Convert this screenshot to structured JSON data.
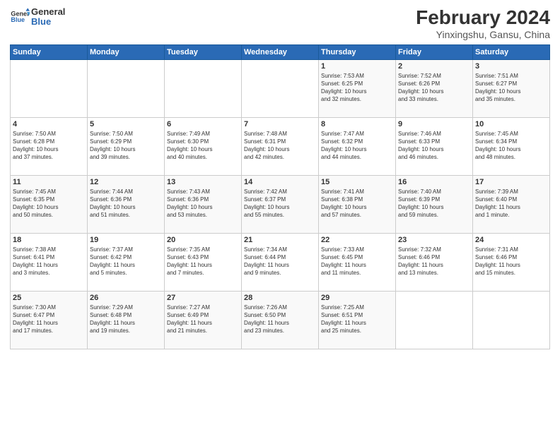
{
  "logo": {
    "line1": "General",
    "line2": "Blue"
  },
  "title": "February 2024",
  "subtitle": "Yinxingshu, Gansu, China",
  "days_of_week": [
    "Sunday",
    "Monday",
    "Tuesday",
    "Wednesday",
    "Thursday",
    "Friday",
    "Saturday"
  ],
  "weeks": [
    [
      {
        "day": "",
        "info": ""
      },
      {
        "day": "",
        "info": ""
      },
      {
        "day": "",
        "info": ""
      },
      {
        "day": "",
        "info": ""
      },
      {
        "day": "1",
        "info": "Sunrise: 7:53 AM\nSunset: 6:25 PM\nDaylight: 10 hours\nand 32 minutes."
      },
      {
        "day": "2",
        "info": "Sunrise: 7:52 AM\nSunset: 6:26 PM\nDaylight: 10 hours\nand 33 minutes."
      },
      {
        "day": "3",
        "info": "Sunrise: 7:51 AM\nSunset: 6:27 PM\nDaylight: 10 hours\nand 35 minutes."
      }
    ],
    [
      {
        "day": "4",
        "info": "Sunrise: 7:50 AM\nSunset: 6:28 PM\nDaylight: 10 hours\nand 37 minutes."
      },
      {
        "day": "5",
        "info": "Sunrise: 7:50 AM\nSunset: 6:29 PM\nDaylight: 10 hours\nand 39 minutes."
      },
      {
        "day": "6",
        "info": "Sunrise: 7:49 AM\nSunset: 6:30 PM\nDaylight: 10 hours\nand 40 minutes."
      },
      {
        "day": "7",
        "info": "Sunrise: 7:48 AM\nSunset: 6:31 PM\nDaylight: 10 hours\nand 42 minutes."
      },
      {
        "day": "8",
        "info": "Sunrise: 7:47 AM\nSunset: 6:32 PM\nDaylight: 10 hours\nand 44 minutes."
      },
      {
        "day": "9",
        "info": "Sunrise: 7:46 AM\nSunset: 6:33 PM\nDaylight: 10 hours\nand 46 minutes."
      },
      {
        "day": "10",
        "info": "Sunrise: 7:45 AM\nSunset: 6:34 PM\nDaylight: 10 hours\nand 48 minutes."
      }
    ],
    [
      {
        "day": "11",
        "info": "Sunrise: 7:45 AM\nSunset: 6:35 PM\nDaylight: 10 hours\nand 50 minutes."
      },
      {
        "day": "12",
        "info": "Sunrise: 7:44 AM\nSunset: 6:36 PM\nDaylight: 10 hours\nand 51 minutes."
      },
      {
        "day": "13",
        "info": "Sunrise: 7:43 AM\nSunset: 6:36 PM\nDaylight: 10 hours\nand 53 minutes."
      },
      {
        "day": "14",
        "info": "Sunrise: 7:42 AM\nSunset: 6:37 PM\nDaylight: 10 hours\nand 55 minutes."
      },
      {
        "day": "15",
        "info": "Sunrise: 7:41 AM\nSunset: 6:38 PM\nDaylight: 10 hours\nand 57 minutes."
      },
      {
        "day": "16",
        "info": "Sunrise: 7:40 AM\nSunset: 6:39 PM\nDaylight: 10 hours\nand 59 minutes."
      },
      {
        "day": "17",
        "info": "Sunrise: 7:39 AM\nSunset: 6:40 PM\nDaylight: 11 hours\nand 1 minute."
      }
    ],
    [
      {
        "day": "18",
        "info": "Sunrise: 7:38 AM\nSunset: 6:41 PM\nDaylight: 11 hours\nand 3 minutes."
      },
      {
        "day": "19",
        "info": "Sunrise: 7:37 AM\nSunset: 6:42 PM\nDaylight: 11 hours\nand 5 minutes."
      },
      {
        "day": "20",
        "info": "Sunrise: 7:35 AM\nSunset: 6:43 PM\nDaylight: 11 hours\nand 7 minutes."
      },
      {
        "day": "21",
        "info": "Sunrise: 7:34 AM\nSunset: 6:44 PM\nDaylight: 11 hours\nand 9 minutes."
      },
      {
        "day": "22",
        "info": "Sunrise: 7:33 AM\nSunset: 6:45 PM\nDaylight: 11 hours\nand 11 minutes."
      },
      {
        "day": "23",
        "info": "Sunrise: 7:32 AM\nSunset: 6:46 PM\nDaylight: 11 hours\nand 13 minutes."
      },
      {
        "day": "24",
        "info": "Sunrise: 7:31 AM\nSunset: 6:46 PM\nDaylight: 11 hours\nand 15 minutes."
      }
    ],
    [
      {
        "day": "25",
        "info": "Sunrise: 7:30 AM\nSunset: 6:47 PM\nDaylight: 11 hours\nand 17 minutes."
      },
      {
        "day": "26",
        "info": "Sunrise: 7:29 AM\nSunset: 6:48 PM\nDaylight: 11 hours\nand 19 minutes."
      },
      {
        "day": "27",
        "info": "Sunrise: 7:27 AM\nSunset: 6:49 PM\nDaylight: 11 hours\nand 21 minutes."
      },
      {
        "day": "28",
        "info": "Sunrise: 7:26 AM\nSunset: 6:50 PM\nDaylight: 11 hours\nand 23 minutes."
      },
      {
        "day": "29",
        "info": "Sunrise: 7:25 AM\nSunset: 6:51 PM\nDaylight: 11 hours\nand 25 minutes."
      },
      {
        "day": "",
        "info": ""
      },
      {
        "day": "",
        "info": ""
      }
    ]
  ]
}
